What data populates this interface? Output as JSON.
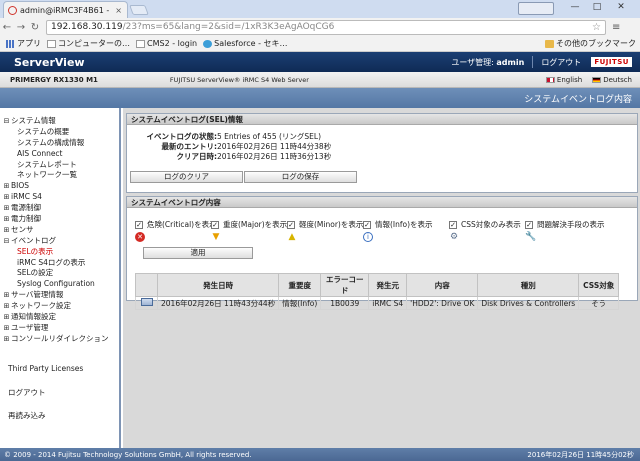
{
  "browser": {
    "tab_title": "admin@iRMC3F4B61 -",
    "tab_close": "×",
    "url_host": "192.168.30.119",
    "url_path": "/23?ms=65&lang=2&sid=/1xR3K3eAgAOqCG6",
    "window_minimize": "—",
    "window_maximize": "□",
    "window_close": "✕",
    "bookmarks": [
      {
        "label": "アプリ",
        "icon": "apps-icon"
      },
      {
        "label": "コンピューターの…",
        "icon": "file-icon"
      },
      {
        "label": "CMS2 - login",
        "icon": "file-icon"
      },
      {
        "label": "Salesforce - セキ…",
        "icon": "salesforce-icon"
      }
    ],
    "other_bookmarks": "その他のブックマーク"
  },
  "header": {
    "title": "ServerView",
    "user_label": "ユーザ管理: ",
    "user_name": "admin",
    "logout": "ログアウト",
    "brand": "FUJITSU",
    "model": "PRIMERGY RX1330 M1",
    "product": "FUJITSU ServerView® iRMC S4 Web Server",
    "lang_en": "English",
    "lang_de": "Deutsch",
    "page_heading": "システムイベントログ内容"
  },
  "sidebar": {
    "items": [
      {
        "label": "システム情報",
        "toggle": "⊟",
        "level": 0
      },
      {
        "label": "システムの概要",
        "toggle": "",
        "level": 1
      },
      {
        "label": "システムの構成情報",
        "toggle": "",
        "level": 1
      },
      {
        "label": "AIS Connect",
        "toggle": "",
        "level": 1
      },
      {
        "label": "システムレポート",
        "toggle": "",
        "level": 1
      },
      {
        "label": "ネットワーク一覧",
        "toggle": "",
        "level": 1
      },
      {
        "label": "BIOS",
        "toggle": "⊞",
        "level": 0
      },
      {
        "label": "iRMC S4",
        "toggle": "⊞",
        "level": 0
      },
      {
        "label": "電源制御",
        "toggle": "⊞",
        "level": 0
      },
      {
        "label": "電力制御",
        "toggle": "⊞",
        "level": 0
      },
      {
        "label": "センサ",
        "toggle": "⊞",
        "level": 0
      },
      {
        "label": "イベントログ",
        "toggle": "⊟",
        "level": 0
      },
      {
        "label": "SELの表示",
        "toggle": "",
        "level": 1,
        "selected": true
      },
      {
        "label": "iRMC S4ログの表示",
        "toggle": "",
        "level": 1
      },
      {
        "label": "SELの設定",
        "toggle": "",
        "level": 1
      },
      {
        "label": "Syslog Configuration",
        "toggle": "",
        "level": 1
      },
      {
        "label": "サーバ管理情報",
        "toggle": "⊞",
        "level": 0
      },
      {
        "label": "ネットワーク設定",
        "toggle": "⊞",
        "level": 0
      },
      {
        "label": "通知情報設定",
        "toggle": "⊞",
        "level": 0
      },
      {
        "label": "ユーザ管理",
        "toggle": "⊞",
        "level": 0
      },
      {
        "label": "コンソールリダイレクション",
        "toggle": "⊞",
        "level": 0
      }
    ],
    "third_party": "Third Party Licenses",
    "logout": "ログアウト",
    "reload": "再読み込み"
  },
  "sel_info": {
    "title": "システムイベントログ(SEL)情報",
    "status_label": "イベントログの状態: ",
    "status_value": "5 Entries of 455 (リングSEL)",
    "latest_label": "最新のエントリ: ",
    "latest_value": "2016年02月26日 11時44分38秒",
    "clear_label": "クリア日時: ",
    "clear_value": "2016年02月26日 11時36分13秒",
    "btn_clear": "ログのクリア",
    "btn_save": "ログの保存"
  },
  "sel_content": {
    "title": "システムイベントログ内容",
    "filters": [
      {
        "label": "危険(Critical)を表示",
        "checked": "✓",
        "icon": "critical-icon",
        "glyph": "✕"
      },
      {
        "label": "重度(Major)を表示",
        "checked": "✓",
        "icon": "major-icon",
        "glyph": "▼"
      },
      {
        "label": "軽度(Minor)を表示",
        "checked": "✓",
        "icon": "minor-icon",
        "glyph": "▲"
      },
      {
        "label": "情報(Info)を表示",
        "checked": "✓",
        "icon": "info-icon",
        "glyph": "i"
      },
      {
        "label": "CSS対象のみ表示",
        "checked": "✓",
        "icon": "css-icon",
        "glyph": "⚙"
      },
      {
        "label": "問題解決手段の表示",
        "checked": "✓",
        "icon": "tools-icon",
        "glyph": "🔧"
      }
    ],
    "apply_button": "適用",
    "table": {
      "headers": [
        "",
        "発生日時",
        "重要度",
        "エラーコード",
        "発生元",
        "内容",
        "種別",
        "CSS対象"
      ],
      "rows": [
        [
          "",
          "2016年02月26日 11時43分44秒",
          "情報(Info)",
          "1B0039",
          "iRMC S4",
          "'HDD2': Drive OK",
          "Disk Drives & Controllers",
          "そう"
        ]
      ]
    }
  },
  "footer": {
    "copyright": "© 2009 - 2014 Fujitsu Technology Solutions GmbH, All rights reserved.",
    "time": "2016年02月26日 11時45分02秒"
  }
}
